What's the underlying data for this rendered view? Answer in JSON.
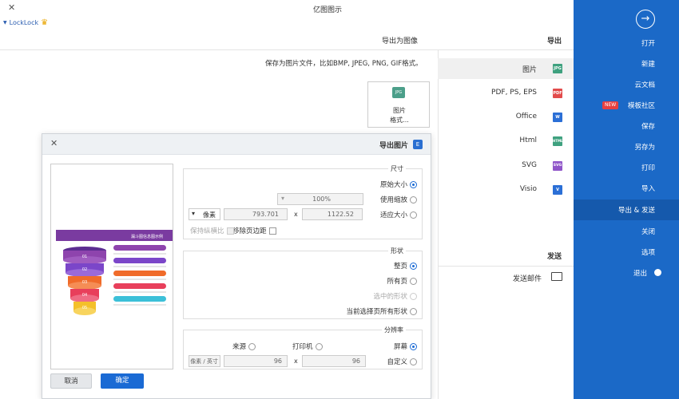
{
  "window": {
    "title": "亿图图示",
    "user": "LockLock"
  },
  "sidebar": {
    "items": [
      {
        "label": "打开"
      },
      {
        "label": "新建"
      },
      {
        "label": "云文档"
      },
      {
        "label": "模板社区",
        "badge": "NEW"
      },
      {
        "label": "保存"
      },
      {
        "label": "另存为"
      },
      {
        "label": "打印"
      },
      {
        "label": "导入"
      },
      {
        "label": "导出 & 发送",
        "active": true
      },
      {
        "label": "关闭"
      },
      {
        "label": "选项"
      },
      {
        "label": "退出"
      }
    ]
  },
  "export_panel": {
    "header": "导出",
    "sub_header": "导出为图像",
    "description": "保存为图片文件，比如BMP, JPEG, PNG, GIF格式。",
    "formats": [
      {
        "label": "图片",
        "icon": "JPG",
        "color": "#3fa17f",
        "active": true
      },
      {
        "label": "PDF, PS, EPS",
        "icon": "PDF",
        "color": "#e24b4b"
      },
      {
        "label": "Office",
        "icon": "W",
        "color": "#2b6fd6"
      },
      {
        "label": "Html",
        "icon": "HTML",
        "color": "#3fa17f"
      },
      {
        "label": "SVG",
        "icon": "SVG",
        "color": "#8f55c9"
      },
      {
        "label": "Visio",
        "icon": "V",
        "color": "#2b6fd6"
      }
    ],
    "send_header": "发送",
    "send_item": "发送邮件",
    "card": {
      "icon": "JPG",
      "line1": "图片",
      "line2": "格式..."
    }
  },
  "dialog": {
    "title": "导出图片",
    "size_group": {
      "title": "尺寸",
      "original": "原始大小",
      "use_zoom": "使用缩放",
      "zoom_value": "100%",
      "fit_size": "适应大小",
      "width": "1122.52",
      "times": "x",
      "height": "793.701",
      "unit": "像素",
      "remove_margin": "移除页边距",
      "keep_ratio": "保持纵横比"
    },
    "shape_group": {
      "title": "形状",
      "current_page": "整页",
      "all_pages": "所有页",
      "selected_shape": "选中的形状",
      "current_page_shapes": "当前选择页所有形状"
    },
    "resolution_group": {
      "title": "分辨率",
      "screen": "屏幕",
      "printer": "打印机",
      "source": "来源",
      "custom": "自定义",
      "dpi_x": "96",
      "times": "x",
      "dpi_y": "96",
      "dpi_unit": "像素 / 英寸"
    },
    "ok": "确定",
    "cancel": "取消"
  },
  "preview": {
    "title": "漏斗图信息图示例",
    "levels": [
      "01",
      "02",
      "03",
      "04",
      "05"
    ]
  }
}
